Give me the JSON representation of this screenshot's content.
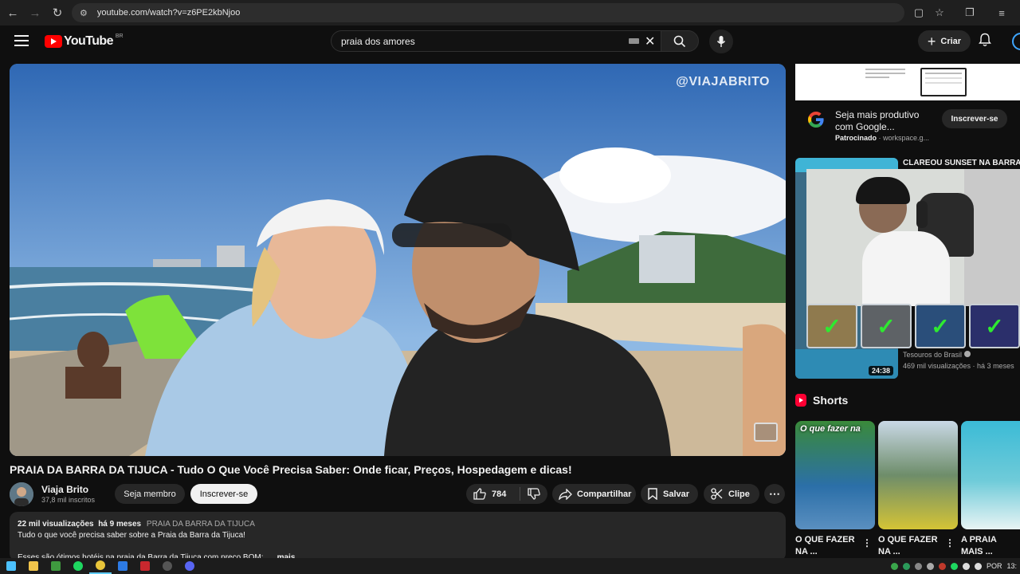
{
  "browser": {
    "url": "youtube.com/watch?v=z6PE2kbNjoo"
  },
  "header": {
    "logo_text": "YouTube",
    "region": "BR",
    "search_query": "praia dos amores",
    "create_label": "Criar"
  },
  "video": {
    "watermark": "@VIAJABRITO",
    "title": "PRAIA DA BARRA DA TIJUCA - Tudo O Que Você Precisa Saber: Onde ficar, Preços, Hospedagem e dicas!",
    "channel_name": "Viaja Brito",
    "subscribers": "37,8 mil inscritos",
    "member_label": "Seja membro",
    "subscribe_label": "Inscrever-se",
    "likes": "784",
    "share_label": "Compartilhar",
    "save_label": "Salvar",
    "clip_label": "Clipe"
  },
  "description": {
    "views": "22 mil visualizações",
    "age": "há 9 meses",
    "tag": "PRAIA DA BARRA DA TIJUCA",
    "line1": "Tudo o que você precisa saber sobre a Praia da Barra da Tijuca!",
    "line3": "Esses são ótimos hotéis na praia da Barra da Tijuca com preço BOM: ",
    "more": "...mais"
  },
  "ad": {
    "title": "Seja mais produtivo com Google...",
    "sponsored": "Patrocinado",
    "domain": "workspace.g...",
    "button": "Inscrever-se"
  },
  "recommended": {
    "title": "CLAREOU SUNSET NA BARRA",
    "channel": "Tesouros do Brasil",
    "views": "469 mil visualizações",
    "age": "há 3 meses",
    "duration": "24:38"
  },
  "shorts": {
    "heading": "Shorts",
    "items": [
      {
        "overlay": "O que fazer na",
        "title": "O QUE FAZER NA ..."
      },
      {
        "overlay": "",
        "title": "O QUE FAZER NA ..."
      },
      {
        "overlay": "",
        "title": "A PRAIA MAIS ..."
      }
    ]
  },
  "taskbar": {
    "language": "POR",
    "time": "13:"
  },
  "colors": {
    "accent_red": "#ff0000",
    "background": "#0f0f0f",
    "surface": "#272727",
    "check_green": "#2eea30"
  }
}
